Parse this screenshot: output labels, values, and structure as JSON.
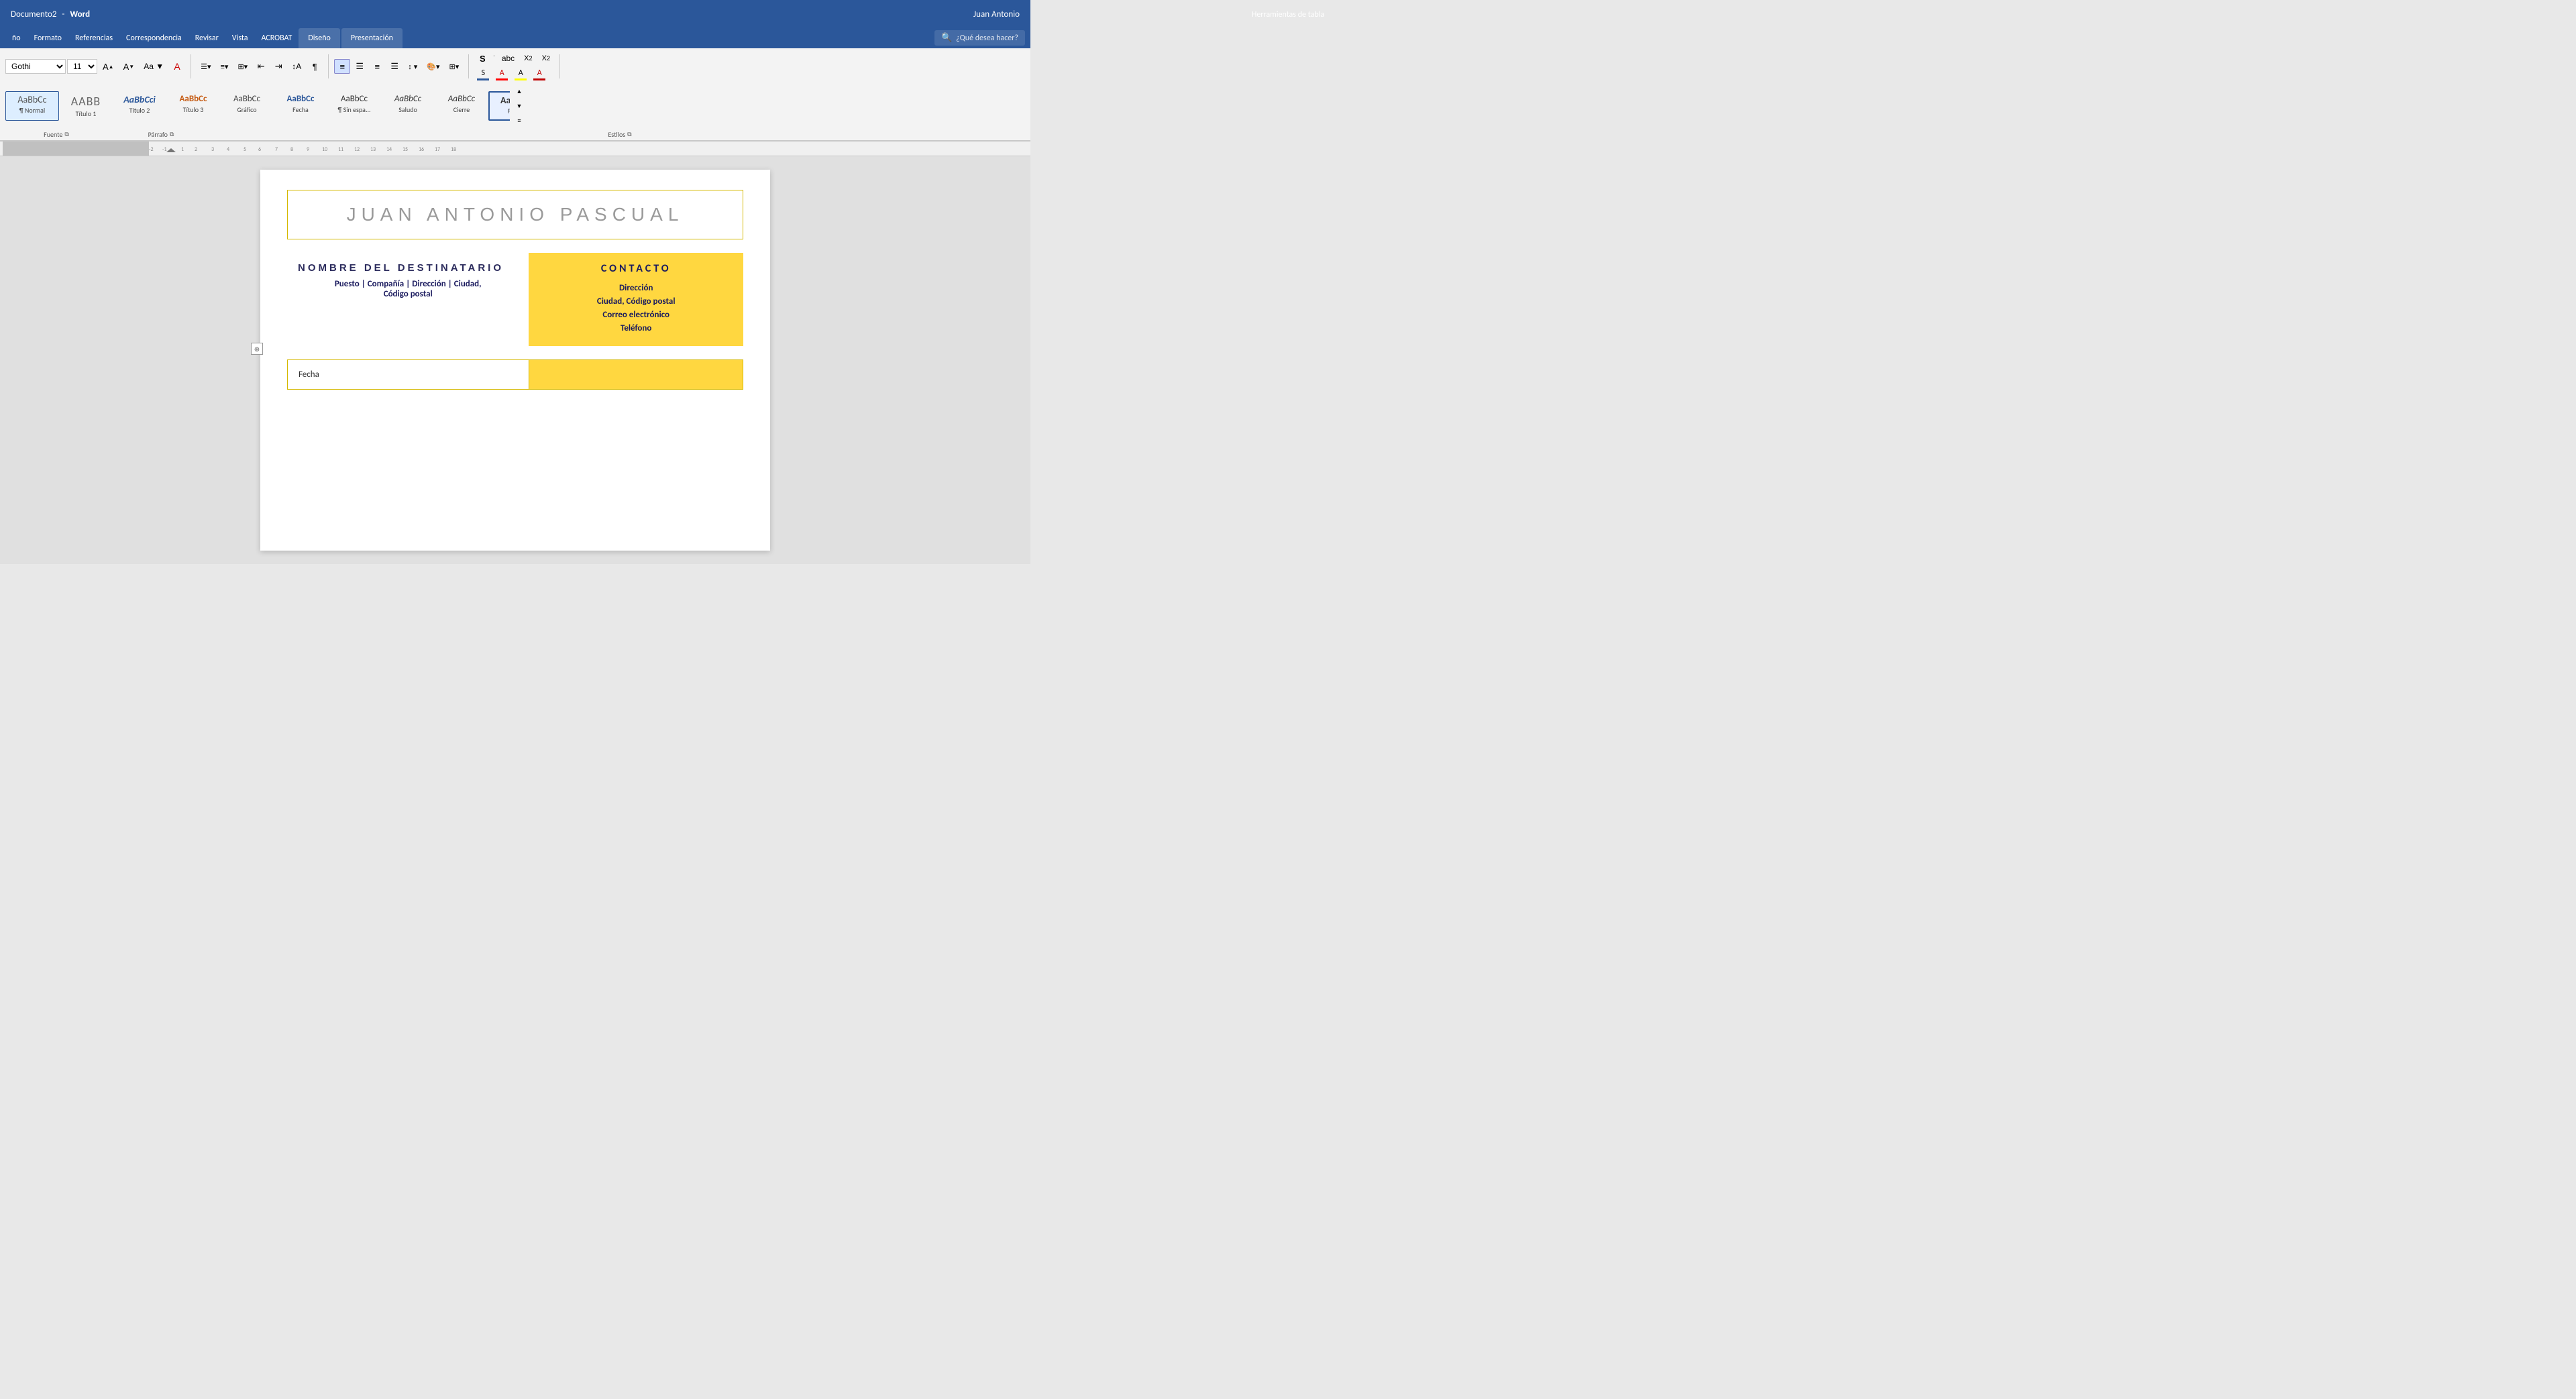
{
  "titleBar": {
    "docName": "Documento2",
    "separator": " - ",
    "appName": "Word",
    "tableTools": "Herramientas de tabla",
    "userName": "Juan Antonio"
  },
  "menuBar": {
    "items": [
      {
        "id": "archivo",
        "label": "ño"
      },
      {
        "id": "formato",
        "label": "Formato"
      },
      {
        "id": "referencias",
        "label": "Referencias"
      },
      {
        "id": "correspondencia",
        "label": "Correspondencia"
      },
      {
        "id": "revisar",
        "label": "Revisar"
      },
      {
        "id": "vista",
        "label": "Vista"
      },
      {
        "id": "acrobat",
        "label": "ACROBAT"
      },
      {
        "id": "diseno",
        "label": "Diseño",
        "active": true
      },
      {
        "id": "presentacion",
        "label": "Presentación",
        "active": true
      }
    ],
    "searchPlaceholder": "¿Qué desea hacer?"
  },
  "ribbon": {
    "fontGroup": {
      "fontName": "Gothi",
      "fontSize": "11",
      "label": "Fuente"
    },
    "paragraphGroup": {
      "label": "Párrafo"
    },
    "estilosLabel": "Estilos",
    "styles": [
      {
        "id": "normal",
        "preview": "AaBbCc",
        "label": "¶ Normal",
        "active": true
      },
      {
        "id": "titulo1",
        "preview": "AABB",
        "label": "Título 1"
      },
      {
        "id": "titulo2",
        "preview": "AaBbCci",
        "label": "Título 2"
      },
      {
        "id": "titulo3",
        "preview": "AaBbCc",
        "label": "Título 3"
      },
      {
        "id": "grafico",
        "preview": "AaBbCc",
        "label": "Gráfico"
      },
      {
        "id": "fecha",
        "preview": "AaBbCc",
        "label": "Fecha"
      },
      {
        "id": "sinespacio",
        "preview": "AaBbCc",
        "label": "¶ Sin espa..."
      },
      {
        "id": "saludo",
        "preview": "AaBbCc",
        "label": "Saludo"
      },
      {
        "id": "cierre",
        "preview": "AaBbCc",
        "label": "Cierre"
      },
      {
        "id": "firma",
        "preview": "AaBbCc",
        "label": "Firma",
        "selected": true
      }
    ]
  },
  "ruler": {
    "marks": [
      "-2",
      "-1",
      "1",
      "2",
      "3",
      "4",
      "5",
      "6",
      "7",
      "8",
      "9",
      "10",
      "11",
      "12",
      "13",
      "14",
      "15",
      "16",
      "17",
      "18"
    ]
  },
  "document": {
    "header": {
      "title": "JUAN ANTONIO PASCUAL"
    },
    "recipient": {
      "name": "NOMBRE DEL DESTINATARIO",
      "details": "Puesto | Compañía | Dirección | Ciudad,\nCódigo postal"
    },
    "contact": {
      "title": "CONTACTO",
      "address": "Dirección",
      "city": "Ciudad, Código postal",
      "email": "Correo electrónico",
      "phone": "Teléfono"
    },
    "date": {
      "label": "Fecha"
    }
  }
}
